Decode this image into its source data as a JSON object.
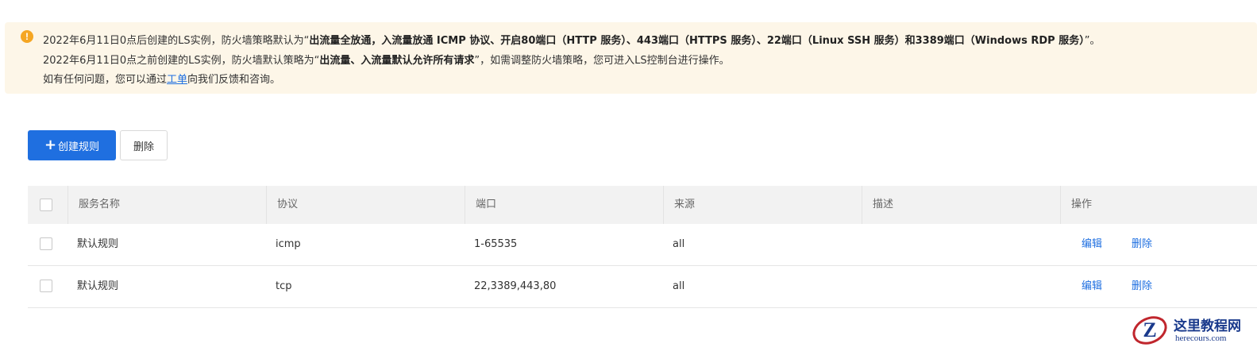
{
  "notice": {
    "icon": "warning-icon",
    "line1_prefix": "2022年6月11日0点后创建的LS实例，防火墙策略默认为“",
    "line1_bold": "出流量全放通，入流量放通 ICMP 协议、开启80端口（HTTP 服务）、443端口（HTTPS 服务）、22端口（Linux SSH 服务）和3389端口（Windows RDP 服务）",
    "line1_suffix": "”。",
    "line2_prefix": "2022年6月11日0点之前创建的LS实例，防火墙默认策略为“",
    "line2_bold": "出流量、入流量默认允许所有请求",
    "line2_suffix": "”，如需调整防火墙策略，您可进入LS控制台进行操作。",
    "line3_prefix": "如有任何问题，您可以通过",
    "line3_link": "工单",
    "line3_suffix": "向我们反馈和咨询。"
  },
  "toolbar": {
    "create_plus": "+",
    "create_label": "创建规则",
    "delete_label": "删除"
  },
  "table": {
    "columns": [
      "服务名称",
      "协议",
      "端口",
      "来源",
      "描述",
      "操作"
    ],
    "rows": [
      {
        "name": "默认规则",
        "protocol": "icmp",
        "port": "1-65535",
        "source": "all",
        "desc": "",
        "edit": "编辑",
        "delete": "删除"
      },
      {
        "name": "默认规则",
        "protocol": "tcp",
        "port": "22,3389,443,80",
        "source": "all",
        "desc": "",
        "edit": "编辑",
        "delete": "删除"
      }
    ]
  },
  "watermark": {
    "title": "这里教程网",
    "subtitle": "herecours.com",
    "logo_letter": "Z"
  },
  "colors": {
    "accent": "#1f6fe0",
    "notice_bg": "#fdf6e8",
    "warning": "#f5a623"
  }
}
